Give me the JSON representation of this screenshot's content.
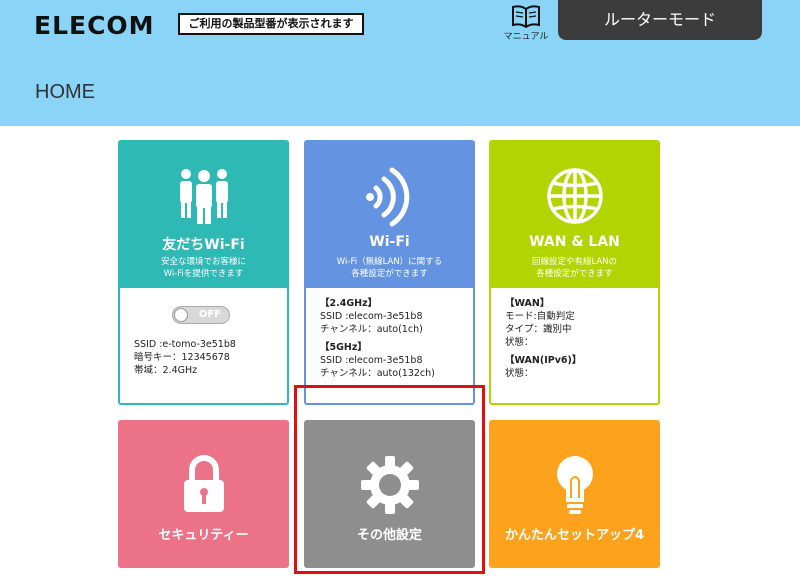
{
  "header": {
    "logo": "ELECOM",
    "model_notice": "ご利用の製品型番が表示されます",
    "manual_label": "マニュアル",
    "mode_button": "ルーターモード",
    "page_title": "HOME"
  },
  "cards": {
    "friends_wifi": {
      "title": "友だちWi-Fi",
      "desc_line1": "安全な環境でお客様に",
      "desc_line2": "Wi-Fiを提供できます",
      "toggle_state": "OFF",
      "ssid": "SSID :e-tomo-3e51b8",
      "key": "暗号キー：12345678",
      "band": "帯域：2.4GHz",
      "color": "#2fb9b4"
    },
    "wifi": {
      "title": "Wi-Fi",
      "desc_line1": "Wi-Fi（無線LAN）に関する",
      "desc_line2": "各種設定ができます",
      "band24_head": "【2.4GHz】",
      "band24_ssid": "SSID :elecom-3e51b8",
      "band24_channel": "チャンネル：auto(1ch)",
      "band5_head": "【5GHz】",
      "band5_ssid": "SSID :elecom-3e51b8",
      "band5_channel": "チャンネル：auto(132ch)",
      "color": "#6493e2"
    },
    "wan_lan": {
      "title": "WAN & LAN",
      "desc_line1": "回線設定や有線LANの",
      "desc_line2": "各種設定ができます",
      "wan_head": "【WAN】",
      "wan_mode": "モード:自動判定",
      "wan_type": "タイプ：識別中",
      "wan_status": "状態：",
      "ipv6_head": "【WAN(IPv6)】",
      "ipv6_status": "状態：",
      "color": "#b2d400"
    }
  },
  "tiles": {
    "security": {
      "label": "セキュリティー",
      "color": "#ec7387"
    },
    "other_settings": {
      "label": "その他設定",
      "color": "#8e8e8e"
    },
    "easy_setup": {
      "label": "かんたんセットアップ4",
      "color": "#fca21d"
    }
  },
  "colors": {
    "header_bg": "#8ad4f7",
    "mode_button_bg": "#3c3c3c",
    "highlight": "#e01010"
  },
  "icons": [
    "book-icon",
    "people-icon",
    "wifi-signal-icon",
    "globe-icon",
    "lock-icon",
    "gear-icon",
    "lightbulb-icon"
  ]
}
